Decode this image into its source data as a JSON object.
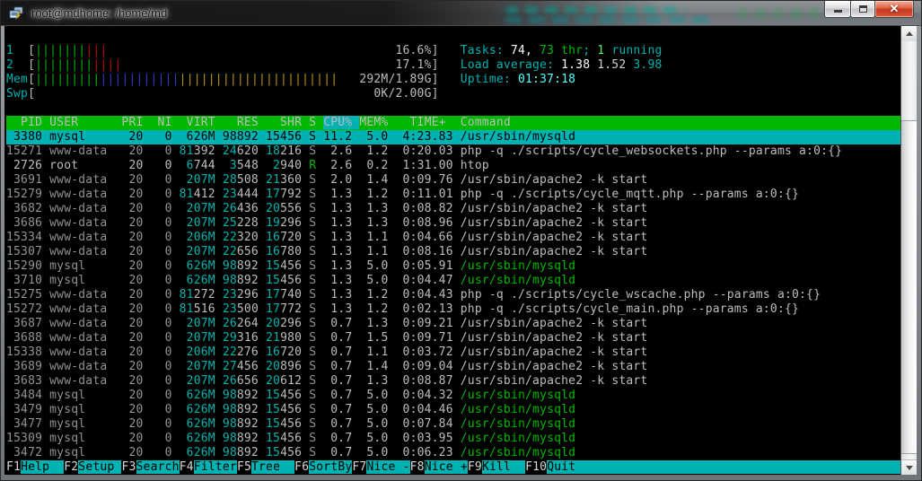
{
  "window": {
    "title": "root@mdhome: /home/md",
    "controls": [
      "minimize",
      "maximize",
      "close"
    ]
  },
  "palette": {
    "green": "#00b800",
    "bgreen": "#55ee55",
    "cyan": "#00b2b2",
    "bcyan": "#55ffff",
    "red": "#b41414",
    "blue": "#3a3ac8",
    "yellow": "#b89a00",
    "white": "#ffffff",
    "lgray": "#d2d2d2",
    "norm": "#bdbdbd",
    "dim": "#929292"
  },
  "meters": {
    "inner_width": 55,
    "rows": [
      {
        "label": "1",
        "value": "16.6%",
        "bars": [
          {
            "color": "green",
            "count": 7
          },
          {
            "color": "red",
            "count": 3
          }
        ]
      },
      {
        "label": "2",
        "value": "17.1%",
        "bars": [
          {
            "color": "green",
            "count": 8
          },
          {
            "color": "red",
            "count": 4
          }
        ]
      },
      {
        "label": "Mem",
        "value": "292M/1.89G",
        "bars": [
          {
            "color": "green",
            "count": 9
          },
          {
            "color": "blue",
            "count": 11
          },
          {
            "color": "yellow",
            "count": 22
          }
        ]
      },
      {
        "label": "Swp",
        "value": "0K/2.00G",
        "bars": []
      }
    ]
  },
  "summary": {
    "lines": [
      [
        {
          "text": "Tasks: ",
          "color": "cyan"
        },
        {
          "text": "74, ",
          "color": "white"
        },
        {
          "text": "73 thr",
          "color": "green"
        },
        {
          "text": "; ",
          "color": "cyan"
        },
        {
          "text": "1",
          "color": "bgreen"
        },
        {
          "text": " running",
          "color": "cyan"
        }
      ],
      [
        {
          "text": "Load average: ",
          "color": "cyan"
        },
        {
          "text": "1.38 ",
          "color": "white"
        },
        {
          "text": "1.52 ",
          "color": "lgray"
        },
        {
          "text": "3.98",
          "color": "cyan"
        }
      ],
      [
        {
          "text": "Uptime: ",
          "color": "cyan"
        },
        {
          "text": "01:37:18",
          "color": "bcyan"
        }
      ]
    ]
  },
  "table": {
    "header_segments": [
      {
        "text": "  PID USER      PRI  NI  VIRT   RES   SHR S ",
        "sort": false
      },
      {
        "text": "CPU% ",
        "sort": true
      },
      {
        "text": "MEM%   TIME+  Command",
        "sort": false
      }
    ],
    "rows": [
      {
        "pid": "3380",
        "user": "mysql",
        "pri": "20",
        "ni": "0",
        "virt": "626M",
        "res": "98892",
        "shr": "15456",
        "s": "S",
        "cpu": "11.2",
        "mem": "5.0",
        "time": "4:23.83",
        "cmd": "/usr/sbin/mysqld",
        "style": "selected"
      },
      {
        "pid": "15271",
        "user": "www-data",
        "pri": "20",
        "ni": "0",
        "virt": "81392",
        "res": "24620",
        "shr": "18216",
        "s": "S",
        "cpu": "2.6",
        "mem": "1.2",
        "time": "0:20.03",
        "cmd": "php -q ./scripts/cycle_websockets.php --params a:0:{}",
        "style": "dim"
      },
      {
        "pid": "2726",
        "user": "root",
        "pri": "20",
        "ni": "0",
        "virt": "6744",
        "res": "3548",
        "shr": "2940",
        "s": "R",
        "cpu": "2.6",
        "mem": "0.2",
        "time": "1:31.00",
        "cmd": "htop",
        "style": "norm"
      },
      {
        "pid": "3691",
        "user": "www-data",
        "pri": "20",
        "ni": "0",
        "virt": "207M",
        "res": "28508",
        "shr": "21360",
        "s": "S",
        "cpu": "2.0",
        "mem": "1.4",
        "time": "0:09.76",
        "cmd": "/usr/sbin/apache2 -k start",
        "style": "dim"
      },
      {
        "pid": "15279",
        "user": "www-data",
        "pri": "20",
        "ni": "0",
        "virt": "81412",
        "res": "23444",
        "shr": "17792",
        "s": "S",
        "cpu": "1.3",
        "mem": "1.2",
        "time": "0:11.01",
        "cmd": "php -q ./scripts/cycle_mqtt.php --params a:0:{}",
        "style": "dim"
      },
      {
        "pid": "3682",
        "user": "www-data",
        "pri": "20",
        "ni": "0",
        "virt": "207M",
        "res": "26436",
        "shr": "20556",
        "s": "S",
        "cpu": "1.3",
        "mem": "1.3",
        "time": "0:08.82",
        "cmd": "/usr/sbin/apache2 -k start",
        "style": "dim"
      },
      {
        "pid": "3686",
        "user": "www-data",
        "pri": "20",
        "ni": "0",
        "virt": "207M",
        "res": "25228",
        "shr": "19296",
        "s": "S",
        "cpu": "1.3",
        "mem": "1.3",
        "time": "0:08.96",
        "cmd": "/usr/sbin/apache2 -k start",
        "style": "dim"
      },
      {
        "pid": "15334",
        "user": "www-data",
        "pri": "20",
        "ni": "0",
        "virt": "206M",
        "res": "22320",
        "shr": "16720",
        "s": "S",
        "cpu": "1.3",
        "mem": "1.1",
        "time": "0:04.66",
        "cmd": "/usr/sbin/apache2 -k start",
        "style": "dim"
      },
      {
        "pid": "15307",
        "user": "www-data",
        "pri": "20",
        "ni": "0",
        "virt": "207M",
        "res": "22656",
        "shr": "16780",
        "s": "S",
        "cpu": "1.3",
        "mem": "1.1",
        "time": "0:08.16",
        "cmd": "/usr/sbin/apache2 -k start",
        "style": "dim"
      },
      {
        "pid": "15290",
        "user": "mysql",
        "pri": "20",
        "ni": "0",
        "virt": "626M",
        "res": "98892",
        "shr": "15456",
        "s": "S",
        "cpu": "1.3",
        "mem": "5.0",
        "time": "0:05.91",
        "cmd": "/usr/sbin/mysqld",
        "style": "thread"
      },
      {
        "pid": "3710",
        "user": "mysql",
        "pri": "20",
        "ni": "0",
        "virt": "626M",
        "res": "98892",
        "shr": "15456",
        "s": "S",
        "cpu": "1.3",
        "mem": "5.0",
        "time": "0:04.47",
        "cmd": "/usr/sbin/mysqld",
        "style": "thread"
      },
      {
        "pid": "15275",
        "user": "www-data",
        "pri": "20",
        "ni": "0",
        "virt": "81272",
        "res": "23296",
        "shr": "17740",
        "s": "S",
        "cpu": "1.3",
        "mem": "1.2",
        "time": "0:04.43",
        "cmd": "php -q ./scripts/cycle_wscache.php --params a:0:{}",
        "style": "dim"
      },
      {
        "pid": "15272",
        "user": "www-data",
        "pri": "20",
        "ni": "0",
        "virt": "81516",
        "res": "23500",
        "shr": "17772",
        "s": "S",
        "cpu": "1.3",
        "mem": "1.2",
        "time": "0:02.13",
        "cmd": "php -q ./scripts/cycle_main.php --params a:0:{}",
        "style": "dim"
      },
      {
        "pid": "3687",
        "user": "www-data",
        "pri": "20",
        "ni": "0",
        "virt": "207M",
        "res": "26264",
        "shr": "20296",
        "s": "S",
        "cpu": "0.7",
        "mem": "1.3",
        "time": "0:09.21",
        "cmd": "/usr/sbin/apache2 -k start",
        "style": "dim"
      },
      {
        "pid": "3688",
        "user": "www-data",
        "pri": "20",
        "ni": "0",
        "virt": "207M",
        "res": "29316",
        "shr": "21980",
        "s": "S",
        "cpu": "0.7",
        "mem": "1.5",
        "time": "0:09.71",
        "cmd": "/usr/sbin/apache2 -k start",
        "style": "dim"
      },
      {
        "pid": "15338",
        "user": "www-data",
        "pri": "20",
        "ni": "0",
        "virt": "206M",
        "res": "22276",
        "shr": "16720",
        "s": "S",
        "cpu": "0.7",
        "mem": "1.1",
        "time": "0:03.72",
        "cmd": "/usr/sbin/apache2 -k start",
        "style": "dim"
      },
      {
        "pid": "3689",
        "user": "www-data",
        "pri": "20",
        "ni": "0",
        "virt": "207M",
        "res": "27456",
        "shr": "20896",
        "s": "S",
        "cpu": "0.7",
        "mem": "1.4",
        "time": "0:09.04",
        "cmd": "/usr/sbin/apache2 -k start",
        "style": "dim"
      },
      {
        "pid": "3683",
        "user": "www-data",
        "pri": "20",
        "ni": "0",
        "virt": "207M",
        "res": "26656",
        "shr": "20612",
        "s": "S",
        "cpu": "0.7",
        "mem": "1.3",
        "time": "0:08.87",
        "cmd": "/usr/sbin/apache2 -k start",
        "style": "dim"
      },
      {
        "pid": "3484",
        "user": "mysql",
        "pri": "20",
        "ni": "0",
        "virt": "626M",
        "res": "98892",
        "shr": "15456",
        "s": "S",
        "cpu": "0.7",
        "mem": "5.0",
        "time": "0:04.32",
        "cmd": "/usr/sbin/mysqld",
        "style": "thread"
      },
      {
        "pid": "3479",
        "user": "mysql",
        "pri": "20",
        "ni": "0",
        "virt": "626M",
        "res": "98892",
        "shr": "15456",
        "s": "S",
        "cpu": "0.7",
        "mem": "5.0",
        "time": "0:04.46",
        "cmd": "/usr/sbin/mysqld",
        "style": "thread"
      },
      {
        "pid": "3477",
        "user": "mysql",
        "pri": "20",
        "ni": "0",
        "virt": "626M",
        "res": "98892",
        "shr": "15456",
        "s": "S",
        "cpu": "0.7",
        "mem": "5.0",
        "time": "0:07.84",
        "cmd": "/usr/sbin/mysqld",
        "style": "thread"
      },
      {
        "pid": "15309",
        "user": "mysql",
        "pri": "20",
        "ni": "0",
        "virt": "626M",
        "res": "98892",
        "shr": "15456",
        "s": "S",
        "cpu": "0.7",
        "mem": "5.0",
        "time": "0:03.95",
        "cmd": "/usr/sbin/mysqld",
        "style": "thread"
      },
      {
        "pid": "3472",
        "user": "mysql",
        "pri": "20",
        "ni": "0",
        "virt": "626M",
        "res": "98892",
        "shr": "15456",
        "s": "S",
        "cpu": "0.7",
        "mem": "5.0",
        "time": "0:06.23",
        "cmd": "/usr/sbin/mysqld",
        "style": "thread"
      }
    ]
  },
  "fkeys": [
    {
      "key": "F1",
      "label": "Help  "
    },
    {
      "key": "F2",
      "label": "Setup "
    },
    {
      "key": "F3",
      "label": "Search"
    },
    {
      "key": "F4",
      "label": "Filter"
    },
    {
      "key": "F5",
      "label": "Tree  "
    },
    {
      "key": "F6",
      "label": "SortBy"
    },
    {
      "key": "F7",
      "label": "Nice -"
    },
    {
      "key": "F8",
      "label": "Nice +"
    },
    {
      "key": "F9",
      "label": "Kill  "
    },
    {
      "key": "F10",
      "label": "Quit  "
    }
  ]
}
